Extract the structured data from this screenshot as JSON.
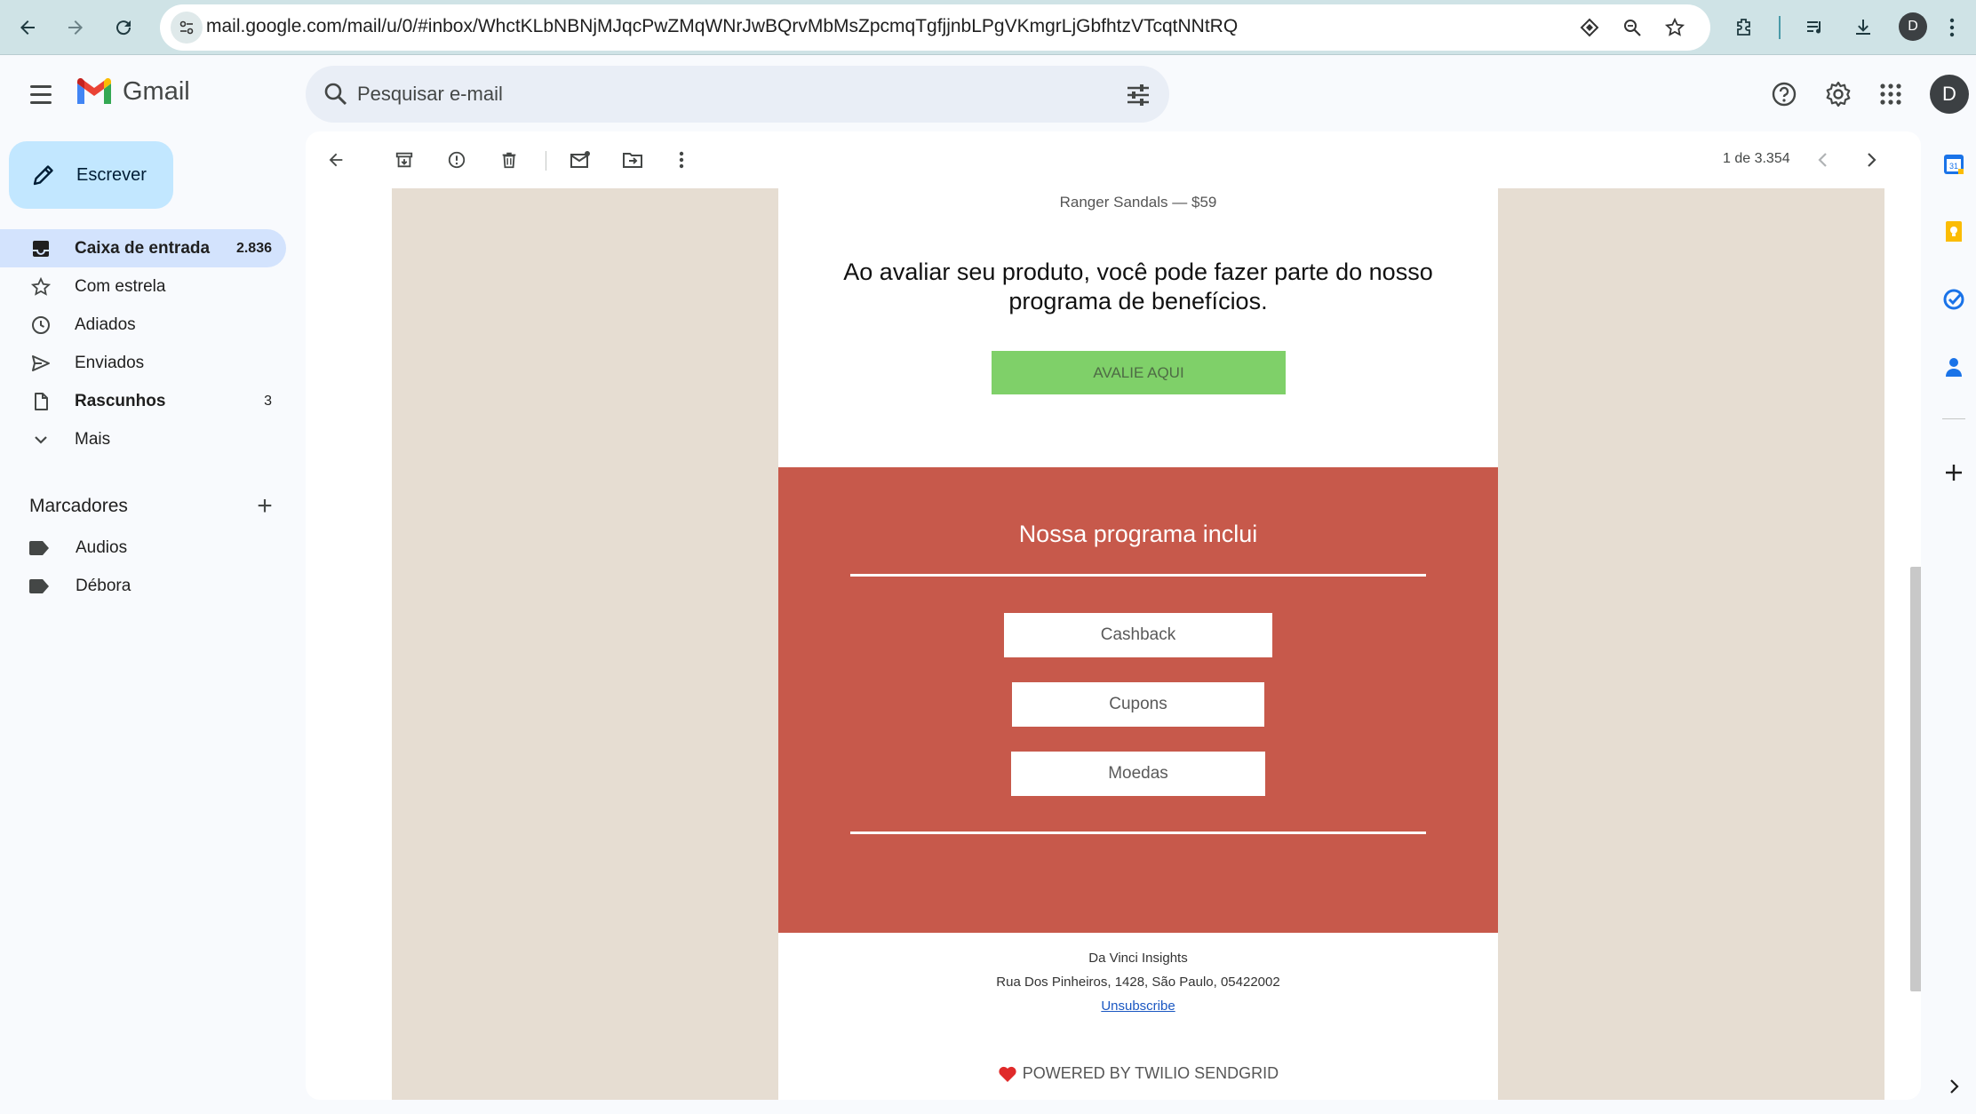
{
  "browser": {
    "url": "mail.google.com/mail/u/0/#inbox/WhctKLbNBNjMJqcPwZMqWNrJwBQrvMbMsZpcmqTgfjjnbLPgVKmgrLjGbfhtzVTcqtNNtRQ",
    "profile_initial": "D"
  },
  "gmail": {
    "logo_text": "Gmail",
    "search_placeholder": "Pesquisar e-mail",
    "account_initial": "D"
  },
  "sidebar": {
    "compose_label": "Escrever",
    "items": [
      {
        "label": "Caixa de entrada",
        "count": "2.836",
        "icon": "inbox-icon"
      },
      {
        "label": "Com estrela",
        "count": "",
        "icon": "star-icon"
      },
      {
        "label": "Adiados",
        "count": "",
        "icon": "clock-icon"
      },
      {
        "label": "Enviados",
        "count": "",
        "icon": "send-icon"
      },
      {
        "label": "Rascunhos",
        "count": "3",
        "icon": "draft-icon"
      },
      {
        "label": "Mais",
        "count": "",
        "icon": "chevron-down-icon"
      }
    ],
    "labels_heading": "Marcadores",
    "labels": [
      {
        "label": "Audios"
      },
      {
        "label": "Débora"
      }
    ]
  },
  "toolbar": {
    "pager": "1 de 3.354"
  },
  "email": {
    "product_line": "Ranger Sandals — $59",
    "pitch": "Ao avaliar seu produto, você pode fazer parte do nosso programa de benefícios.",
    "cta_label": "AVALIE AQUI",
    "program_title": "Nossa programa inclui",
    "benefits": [
      "Cashback",
      "Cupons",
      "Moedas"
    ],
    "footer_name": "Da Vinci Insights",
    "footer_address": "Rua Dos Pinheiros, 1428, São Paulo, 05422002",
    "unsubscribe": "Unsubscribe",
    "powered_by": "POWERED BY TWILIO SENDGRID"
  },
  "colors": {
    "cta_green": "#7fd069",
    "program_red": "#c7594b",
    "email_bg": "#e6ddd2",
    "compose_blue": "#c2e7ff",
    "active_nav": "#d3e3fd"
  }
}
